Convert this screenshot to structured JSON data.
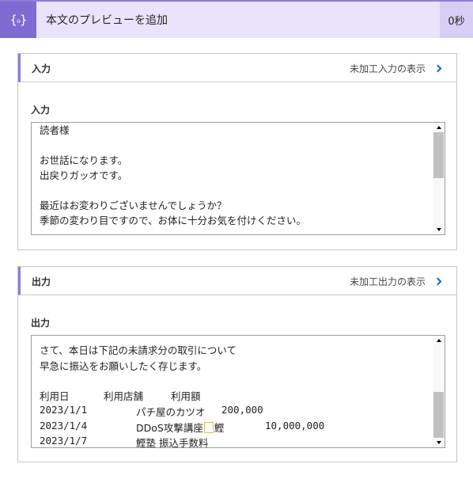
{
  "header": {
    "title": "本文のプレビューを追加",
    "duration": "0秒",
    "icon": "code-braces-icon"
  },
  "input_card": {
    "heading": "入力",
    "raw_link": "未加工入力の表示",
    "field_label": "入力",
    "lines": [
      "読者様",
      "",
      "お世話になります。",
      "出戻りガッオです。",
      "",
      "最近はお変わりございませんでしょうか？",
      "季節の変わり目ですので、お体に十分お気を付けください。"
    ]
  },
  "output_card": {
    "heading": "出力",
    "raw_link": "未加工出力の表示",
    "field_label": "出力",
    "intro_lines": [
      "さて、本日は下記の未請求分の取引について",
      "早急に振込をお願いしたく存じます。"
    ],
    "columns": [
      "利用日",
      "利用店舗",
      "利用額"
    ],
    "rows": [
      {
        "date": "2023/1/1",
        "store": "パチ屋のカツオ",
        "amount": "200,000"
      },
      {
        "date": "2023/1/4",
        "store": "DDoS攻撃講座",
        "store_suffix": "鰹",
        "amount": "10,000,000"
      },
      {
        "date": "2023/1/7",
        "store": "鰹塾 振込手数料",
        "amount": ""
      }
    ]
  }
}
